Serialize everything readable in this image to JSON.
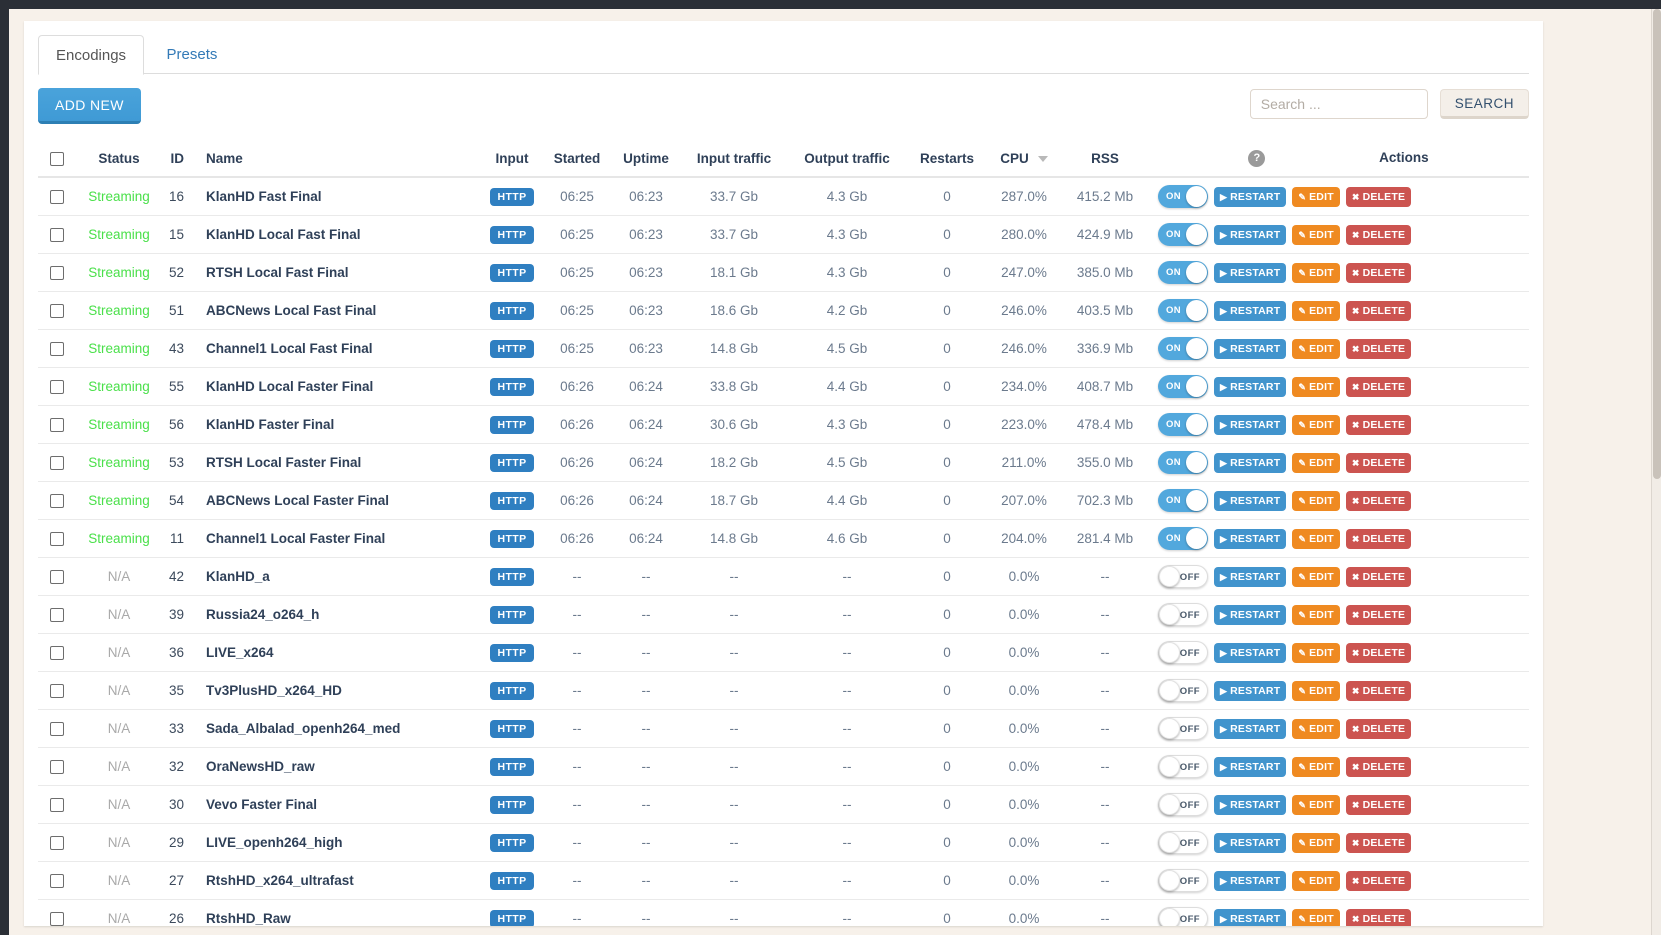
{
  "tabs": [
    {
      "label": "Encodings",
      "active": true
    },
    {
      "label": "Presets",
      "active": false
    }
  ],
  "toolbar": {
    "add_new_label": "ADD NEW",
    "search_placeholder": "Search ...",
    "search_value": "",
    "search_button_label": "SEARCH"
  },
  "table": {
    "headers": {
      "checkbox": "",
      "status": "Status",
      "id": "ID",
      "name": "Name",
      "input": "Input",
      "started": "Started",
      "uptime": "Uptime",
      "input_traffic": "Input traffic",
      "output_traffic": "Output traffic",
      "restarts": "Restarts",
      "cpu": "CPU",
      "rss": "RSS",
      "help": "?",
      "actions": "Actions"
    },
    "sort": {
      "column": "CPU",
      "direction": "desc"
    },
    "action_labels": {
      "restart": "RESTART",
      "edit": "EDIT",
      "delete": "DELETE",
      "toggle_on": "ON",
      "toggle_off": "OFF"
    },
    "rows": [
      {
        "status": "Streaming",
        "id": "16",
        "name": "KlanHD Fast Final",
        "input": "HTTP",
        "started": "06:25",
        "uptime": "06:23",
        "input_traffic": "33.7 Gb",
        "output_traffic": "4.3 Gb",
        "restarts": "0",
        "cpu": "287.0%",
        "rss": "415.2 Mb",
        "toggle": "on"
      },
      {
        "status": "Streaming",
        "id": "15",
        "name": "KlanHD Local Fast Final",
        "input": "HTTP",
        "started": "06:25",
        "uptime": "06:23",
        "input_traffic": "33.7 Gb",
        "output_traffic": "4.3 Gb",
        "restarts": "0",
        "cpu": "280.0%",
        "rss": "424.9 Mb",
        "toggle": "on"
      },
      {
        "status": "Streaming",
        "id": "52",
        "name": "RTSH Local Fast Final",
        "input": "HTTP",
        "started": "06:25",
        "uptime": "06:23",
        "input_traffic": "18.1 Gb",
        "output_traffic": "4.3 Gb",
        "restarts": "0",
        "cpu": "247.0%",
        "rss": "385.0 Mb",
        "toggle": "on"
      },
      {
        "status": "Streaming",
        "id": "51",
        "name": "ABCNews Local Fast Final",
        "input": "HTTP",
        "started": "06:25",
        "uptime": "06:23",
        "input_traffic": "18.6 Gb",
        "output_traffic": "4.2 Gb",
        "restarts": "0",
        "cpu": "246.0%",
        "rss": "403.5 Mb",
        "toggle": "on"
      },
      {
        "status": "Streaming",
        "id": "43",
        "name": "Channel1 Local Fast Final",
        "input": "HTTP",
        "started": "06:25",
        "uptime": "06:23",
        "input_traffic": "14.8 Gb",
        "output_traffic": "4.5 Gb",
        "restarts": "0",
        "cpu": "246.0%",
        "rss": "336.9 Mb",
        "toggle": "on"
      },
      {
        "status": "Streaming",
        "id": "55",
        "name": "KlanHD Local Faster Final",
        "input": "HTTP",
        "started": "06:26",
        "uptime": "06:24",
        "input_traffic": "33.8 Gb",
        "output_traffic": "4.4 Gb",
        "restarts": "0",
        "cpu": "234.0%",
        "rss": "408.7 Mb",
        "toggle": "on"
      },
      {
        "status": "Streaming",
        "id": "56",
        "name": "KlanHD Faster Final",
        "input": "HTTP",
        "started": "06:26",
        "uptime": "06:24",
        "input_traffic": "30.6 Gb",
        "output_traffic": "4.3 Gb",
        "restarts": "0",
        "cpu": "223.0%",
        "rss": "478.4 Mb",
        "toggle": "on"
      },
      {
        "status": "Streaming",
        "id": "53",
        "name": "RTSH Local Faster Final",
        "input": "HTTP",
        "started": "06:26",
        "uptime": "06:24",
        "input_traffic": "18.2 Gb",
        "output_traffic": "4.5 Gb",
        "restarts": "0",
        "cpu": "211.0%",
        "rss": "355.0 Mb",
        "toggle": "on"
      },
      {
        "status": "Streaming",
        "id": "54",
        "name": "ABCNews Local Faster Final",
        "input": "HTTP",
        "started": "06:26",
        "uptime": "06:24",
        "input_traffic": "18.7 Gb",
        "output_traffic": "4.4 Gb",
        "restarts": "0",
        "cpu": "207.0%",
        "rss": "702.3 Mb",
        "toggle": "on"
      },
      {
        "status": "Streaming",
        "id": "11",
        "name": "Channel1 Local Faster Final",
        "input": "HTTP",
        "started": "06:26",
        "uptime": "06:24",
        "input_traffic": "14.8 Gb",
        "output_traffic": "4.6 Gb",
        "restarts": "0",
        "cpu": "204.0%",
        "rss": "281.4 Mb",
        "toggle": "on"
      },
      {
        "status": "N/A",
        "id": "42",
        "name": "KlanHD_a",
        "input": "HTTP",
        "started": "--",
        "uptime": "--",
        "input_traffic": "--",
        "output_traffic": "--",
        "restarts": "0",
        "cpu": "0.0%",
        "rss": "--",
        "toggle": "off"
      },
      {
        "status": "N/A",
        "id": "39",
        "name": "Russia24_o264_h",
        "input": "HTTP",
        "started": "--",
        "uptime": "--",
        "input_traffic": "--",
        "output_traffic": "--",
        "restarts": "0",
        "cpu": "0.0%",
        "rss": "--",
        "toggle": "off"
      },
      {
        "status": "N/A",
        "id": "36",
        "name": "LIVE_x264",
        "input": "HTTP",
        "started": "--",
        "uptime": "--",
        "input_traffic": "--",
        "output_traffic": "--",
        "restarts": "0",
        "cpu": "0.0%",
        "rss": "--",
        "toggle": "off"
      },
      {
        "status": "N/A",
        "id": "35",
        "name": "Tv3PlusHD_x264_HD",
        "input": "HTTP",
        "started": "--",
        "uptime": "--",
        "input_traffic": "--",
        "output_traffic": "--",
        "restarts": "0",
        "cpu": "0.0%",
        "rss": "--",
        "toggle": "off"
      },
      {
        "status": "N/A",
        "id": "33",
        "name": "Sada_Albalad_openh264_med",
        "input": "HTTP",
        "started": "--",
        "uptime": "--",
        "input_traffic": "--",
        "output_traffic": "--",
        "restarts": "0",
        "cpu": "0.0%",
        "rss": "--",
        "toggle": "off"
      },
      {
        "status": "N/A",
        "id": "32",
        "name": "OraNewsHD_raw",
        "input": "HTTP",
        "started": "--",
        "uptime": "--",
        "input_traffic": "--",
        "output_traffic": "--",
        "restarts": "0",
        "cpu": "0.0%",
        "rss": "--",
        "toggle": "off"
      },
      {
        "status": "N/A",
        "id": "30",
        "name": "Vevo Faster Final",
        "input": "HTTP",
        "started": "--",
        "uptime": "--",
        "input_traffic": "--",
        "output_traffic": "--",
        "restarts": "0",
        "cpu": "0.0%",
        "rss": "--",
        "toggle": "off"
      },
      {
        "status": "N/A",
        "id": "29",
        "name": "LIVE_openh264_high",
        "input": "HTTP",
        "started": "--",
        "uptime": "--",
        "input_traffic": "--",
        "output_traffic": "--",
        "restarts": "0",
        "cpu": "0.0%",
        "rss": "--",
        "toggle": "off"
      },
      {
        "status": "N/A",
        "id": "27",
        "name": "RtshHD_x264_ultrafast",
        "input": "HTTP",
        "started": "--",
        "uptime": "--",
        "input_traffic": "--",
        "output_traffic": "--",
        "restarts": "0",
        "cpu": "0.0%",
        "rss": "--",
        "toggle": "off"
      },
      {
        "status": "N/A",
        "id": "26",
        "name": "RtshHD_Raw",
        "input": "HTTP",
        "started": "--",
        "uptime": "--",
        "input_traffic": "--",
        "output_traffic": "--",
        "restarts": "0",
        "cpu": "0.0%",
        "rss": "--",
        "toggle": "off"
      }
    ]
  },
  "colors": {
    "primary": "#4194cd",
    "streaming": "#4ae04a",
    "edit": "#ef8a21",
    "delete": "#cc5450",
    "page_bg": "#f7f1ea"
  }
}
